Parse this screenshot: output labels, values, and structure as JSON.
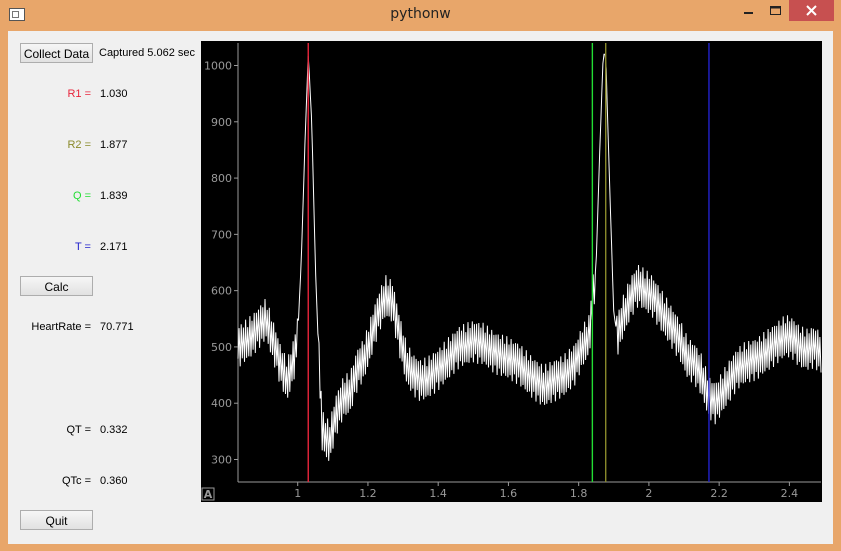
{
  "window": {
    "title": "pythonw",
    "minimize_icon": "minimize-icon",
    "maximize_icon": "maximize-icon",
    "close_icon": "close-icon"
  },
  "left_panel": {
    "collect_label": "Collect Data",
    "captured_text": "Captured 5.062 sec",
    "r1": {
      "label": "R1 =",
      "value": "1.030",
      "color": "#e8253b"
    },
    "r2": {
      "label": "R2 =",
      "value": "1.877",
      "color": "#8a8a2a"
    },
    "q": {
      "label": "Q =",
      "value": "1.839",
      "color": "#22dd33"
    },
    "t": {
      "label": "T =",
      "value": "2.171",
      "color": "#2222cc"
    },
    "calc_label": "Calc",
    "heartrate": {
      "label": "HeartRate =",
      "value": "70.771"
    },
    "qt": {
      "label": "QT =",
      "value": "0.332"
    },
    "qtc": {
      "label": "QTc =",
      "value": "0.360"
    },
    "quit_label": "Quit"
  },
  "plot": {
    "auto_button_label": "A"
  },
  "chart_data": {
    "type": "line",
    "title": "",
    "xlabel": "",
    "ylabel": "",
    "xlim": [
      0.83,
      2.49
    ],
    "ylim": [
      260,
      1040
    ],
    "xticks": [
      1,
      1.2,
      1.4,
      1.6,
      1.8,
      2,
      2.2,
      2.4
    ],
    "xtick_labels": [
      "1",
      "1.2",
      "1.4",
      "1.6",
      "1.8",
      "2",
      "2.2",
      "2.4"
    ],
    "yticks": [
      300,
      400,
      500,
      600,
      700,
      800,
      900,
      1000
    ],
    "ytick_labels": [
      "300",
      "400",
      "500",
      "600",
      "700",
      "800",
      "900",
      "1000"
    ],
    "grid": false,
    "background": "#000000",
    "series_color": "#ffffff",
    "markers": [
      {
        "name": "R1",
        "x": 1.03,
        "color": "#e8253b"
      },
      {
        "name": "Q",
        "x": 1.839,
        "color": "#22dd33"
      },
      {
        "name": "R2",
        "x": 1.877,
        "color": "#8a8a2a"
      },
      {
        "name": "T",
        "x": 2.171,
        "color": "#2222cc"
      }
    ],
    "series": [
      {
        "x": [
          0.83,
          0.87,
          0.91,
          0.93,
          0.95,
          0.97,
          0.99,
          1.0,
          1.01,
          1.02,
          1.03,
          1.04,
          1.05,
          1.06,
          1.07,
          1.09,
          1.11,
          1.13,
          1.15,
          1.17,
          1.19,
          1.21,
          1.23,
          1.25,
          1.27,
          1.29,
          1.31,
          1.33,
          1.35,
          1.37,
          1.4,
          1.43,
          1.46,
          1.5,
          1.53,
          1.56,
          1.6,
          1.63,
          1.66,
          1.7,
          1.73,
          1.76,
          1.79,
          1.81,
          1.83,
          1.85,
          1.86,
          1.87,
          1.877,
          1.89,
          1.9,
          1.91,
          1.93,
          1.95,
          1.97,
          1.99,
          2.01,
          2.03,
          2.05,
          2.07,
          2.09,
          2.11,
          2.13,
          2.15,
          2.17,
          2.19,
          2.21,
          2.23,
          2.25,
          2.27,
          2.29,
          2.31,
          2.33,
          2.35,
          2.37,
          2.39,
          2.41,
          2.43,
          2.45,
          2.47,
          2.49
        ],
        "y": [
          500,
          520,
          550,
          510,
          470,
          440,
          480,
          520,
          650,
          850,
          1020,
          900,
          650,
          480,
          350,
          330,
          380,
          410,
          420,
          460,
          480,
          520,
          560,
          590,
          580,
          520,
          470,
          450,
          440,
          445,
          460,
          480,
          500,
          510,
          505,
          490,
          480,
          470,
          450,
          430,
          440,
          450,
          470,
          500,
          520,
          650,
          850,
          1020,
          1020,
          750,
          560,
          520,
          560,
          590,
          610,
          600,
          590,
          570,
          550,
          530,
          510,
          480,
          470,
          450,
          410,
          400,
          420,
          440,
          460,
          470,
          475,
          480,
          490,
          500,
          510,
          520,
          515,
          500,
          495,
          500,
          490
        ]
      }
    ]
  }
}
